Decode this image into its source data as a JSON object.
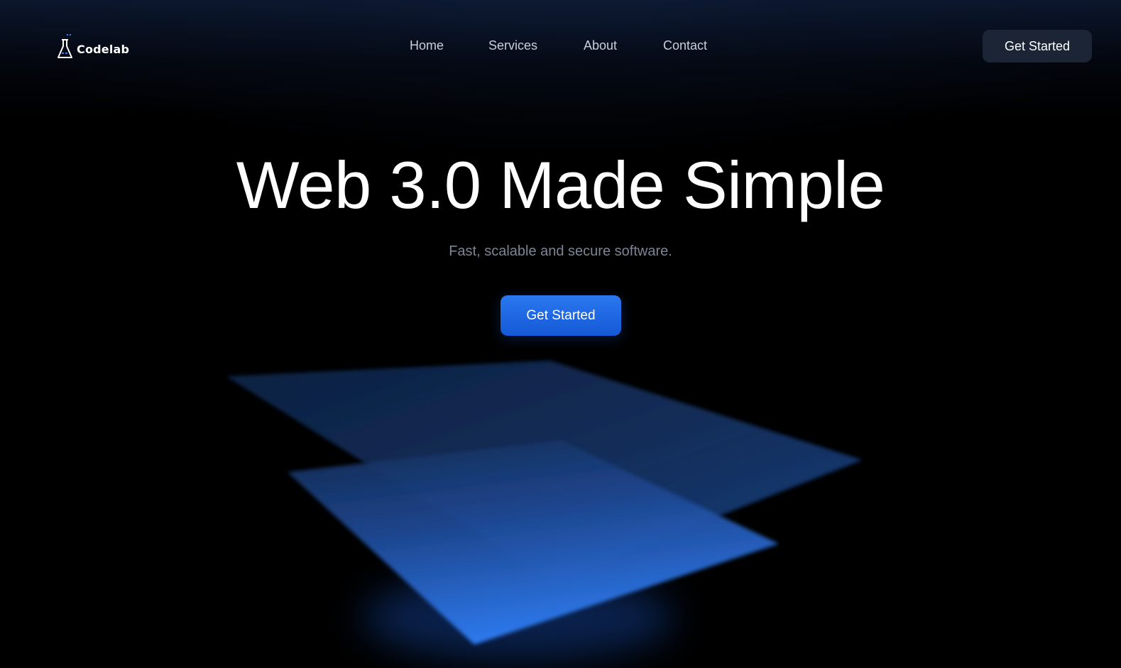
{
  "brand": {
    "name": "Codelab",
    "logo_icon": "flask-icon",
    "accent_color": "#2a78f0"
  },
  "nav": {
    "links": [
      {
        "label": "Home"
      },
      {
        "label": "Services"
      },
      {
        "label": "About"
      },
      {
        "label": "Contact"
      }
    ],
    "cta_label": "Get Started"
  },
  "hero": {
    "title": "Web 3.0 Made Simple",
    "subtitle": "Fast, scalable and secure software.",
    "cta_label": "Get Started"
  }
}
